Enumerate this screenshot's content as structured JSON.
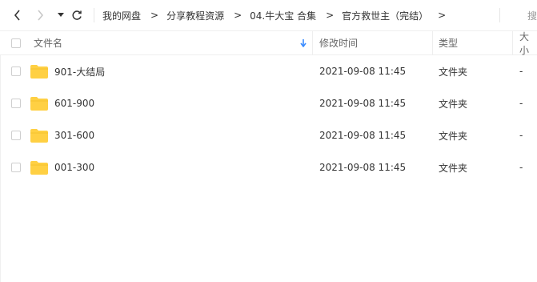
{
  "breadcrumb": {
    "items": [
      "我的网盘",
      "分享教程资源",
      "04.牛大宝 合集",
      "官方救世主（完结）"
    ],
    "separator": ">"
  },
  "search_label": "搜",
  "header": {
    "name": "文件名",
    "modified": "修改时间",
    "type": "类型",
    "size": "大小"
  },
  "files": [
    {
      "name": "901-大结局",
      "modified": "2021-09-08 11:45",
      "type": "文件夹",
      "size": "-"
    },
    {
      "name": "601-900",
      "modified": "2021-09-08 11:45",
      "type": "文件夹",
      "size": "-"
    },
    {
      "name": "301-600",
      "modified": "2021-09-08 11:45",
      "type": "文件夹",
      "size": "-"
    },
    {
      "name": "001-300",
      "modified": "2021-09-08 11:45",
      "type": "文件夹",
      "size": "-"
    }
  ],
  "colors": {
    "folder": "#ffd043",
    "sort_arrow": "#3b8cff"
  }
}
